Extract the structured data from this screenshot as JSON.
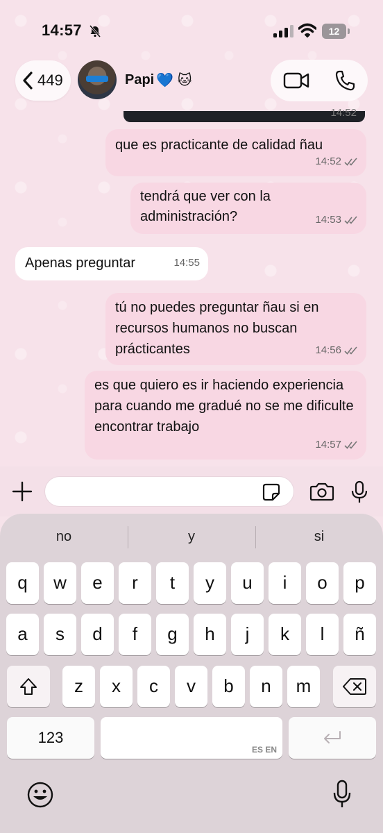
{
  "status_bar": {
    "time": "14:57",
    "battery": "12",
    "icons": [
      "bell-slash-icon",
      "signal-icon",
      "wifi-icon",
      "battery-icon"
    ]
  },
  "header": {
    "back_count": "449",
    "contact_name": "Papi",
    "name_emojis": "💙 🐱",
    "icons": [
      "chevron-left-icon",
      "video-call-icon",
      "phone-icon"
    ]
  },
  "messages": [
    {
      "text": "",
      "time": "14:52",
      "direction": "out",
      "status": "read"
    },
    {
      "text": "que es practicante de calidad ñau",
      "time": "14:52",
      "direction": "out",
      "status": "read"
    },
    {
      "text": "tendrá que ver con la administración?",
      "time": "14:53",
      "direction": "out",
      "status": "read"
    },
    {
      "text": "Apenas preguntar",
      "time": "14:55",
      "direction": "in"
    },
    {
      "text": "tú no puedes preguntar ñau si en recursos humanos no buscan prácticantes",
      "time": "14:56",
      "direction": "out",
      "status": "read"
    },
    {
      "text": "es que quiero es ir haciendo experiencia para cuando me gradué no se me dificulte encontrar trabajo",
      "time": "14:57",
      "direction": "out",
      "status": "read"
    }
  ],
  "composer": {
    "placeholder": "",
    "icons": [
      "plus-icon",
      "sticker-icon",
      "camera-icon",
      "microphone-icon"
    ]
  },
  "keyboard": {
    "suggestions": [
      "no",
      "y",
      "si"
    ],
    "row1": [
      "q",
      "w",
      "e",
      "r",
      "t",
      "y",
      "u",
      "i",
      "o",
      "p"
    ],
    "row2": [
      "a",
      "s",
      "d",
      "f",
      "g",
      "h",
      "j",
      "k",
      "l",
      "ñ"
    ],
    "row3": [
      "z",
      "x",
      "c",
      "v",
      "b",
      "n",
      "m"
    ],
    "numbers_key": "123",
    "language_label": "ES EN",
    "icons": [
      "shift-icon",
      "delete-icon",
      "return-icon",
      "emoji-icon",
      "dictation-icon"
    ]
  },
  "colors": {
    "outgoing_bubble": "#f8d7e3",
    "incoming_bubble": "#ffffff",
    "chat_background": "#f7e2ea",
    "keyboard_background": "#ddd3d8"
  }
}
